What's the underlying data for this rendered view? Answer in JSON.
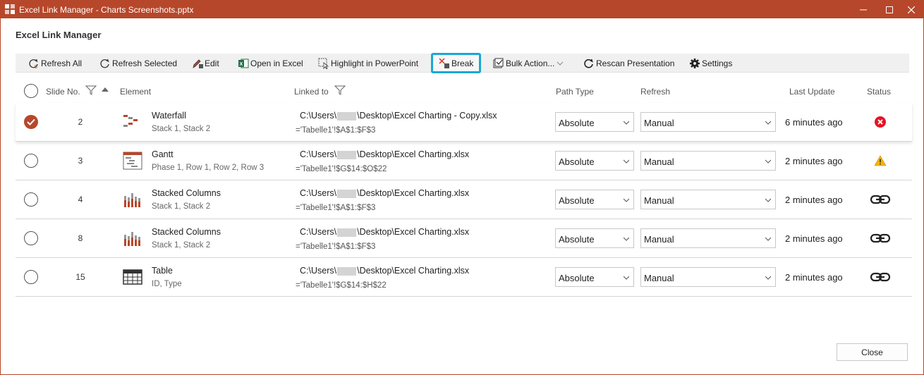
{
  "window": {
    "title": "Excel Link Manager - Charts Screenshots.pptx",
    "accent_color": "#b7472a"
  },
  "heading": "Excel Link Manager",
  "toolbar": {
    "refresh_all": "Refresh All",
    "refresh_selected": "Refresh Selected",
    "edit": "Edit",
    "open_in_excel": "Open in Excel",
    "highlight": "Highlight in PowerPoint",
    "break": "Break",
    "bulk_action": "Bulk Action...",
    "rescan": "Rescan Presentation",
    "settings": "Settings",
    "highlight_color": "#1aa8d6"
  },
  "columns": {
    "slide_no": "Slide No.",
    "element": "Element",
    "linked_to": "Linked to",
    "path_type": "Path Type",
    "refresh": "Refresh",
    "last_update": "Last Update",
    "status": "Status"
  },
  "rows": [
    {
      "selected": true,
      "slide": "2",
      "icon": "waterfall-chart-icon",
      "name": "Waterfall",
      "sub": "Stack 1, Stack 2",
      "path_prefix": "C:\\Users\\",
      "path_suffix": "\\Desktop\\Excel Charting - Copy.xlsx",
      "range": "='Tabelle1'!$A$1:$F$3",
      "path_type": "Absolute",
      "refresh": "Manual",
      "last_update": "6 minutes ago",
      "status": "error-icon"
    },
    {
      "selected": false,
      "slide": "3",
      "icon": "gantt-chart-icon",
      "name": "Gantt",
      "sub": "Phase 1, Row 1, Row 2, Row 3",
      "path_prefix": "C:\\Users\\",
      "path_suffix": "\\Desktop\\Excel Charting.xlsx",
      "range": "='Tabelle1'!$G$14:$O$22",
      "path_type": "Absolute",
      "refresh": "Manual",
      "last_update": "2 minutes ago",
      "status": "warning-icon"
    },
    {
      "selected": false,
      "slide": "4",
      "icon": "stacked-columns-icon",
      "name": "Stacked Columns",
      "sub": "Stack 1, Stack 2",
      "path_prefix": "C:\\Users\\",
      "path_suffix": "\\Desktop\\Excel Charting.xlsx",
      "range": "='Tabelle1'!$A$1:$F$3",
      "path_type": "Absolute",
      "refresh": "Manual",
      "last_update": "2 minutes ago",
      "status": "link-icon"
    },
    {
      "selected": false,
      "slide": "8",
      "icon": "stacked-columns-icon",
      "name": "Stacked Columns",
      "sub": "Stack 1, Stack 2",
      "path_prefix": "C:\\Users\\",
      "path_suffix": "\\Desktop\\Excel Charting.xlsx",
      "range": "='Tabelle1'!$A$1:$F$3",
      "path_type": "Absolute",
      "refresh": "Manual",
      "last_update": "2 minutes ago",
      "status": "link-icon"
    },
    {
      "selected": false,
      "slide": "15",
      "icon": "table-icon",
      "name": "Table",
      "sub": "ID, Type",
      "path_prefix": "C:\\Users\\",
      "path_suffix": "\\Desktop\\Excel Charting.xlsx",
      "range": "='Tabelle1'!$G$14:$H$22",
      "path_type": "Absolute",
      "refresh": "Manual",
      "last_update": "2 minutes ago",
      "status": "link-icon"
    }
  ],
  "footer": {
    "close": "Close"
  }
}
